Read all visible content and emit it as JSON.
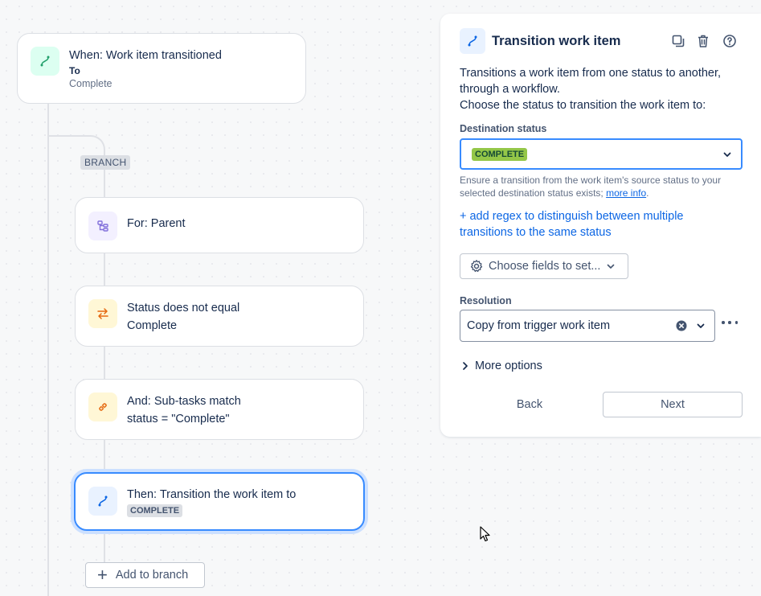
{
  "trigger": {
    "title": "When: Work item transitioned",
    "to_label": "To",
    "to_value": "Complete"
  },
  "branch": {
    "tag": "BRANCH"
  },
  "steps": [
    {
      "line1": "For: Parent",
      "line2": ""
    },
    {
      "line1": "Status does not equal",
      "line2": "Complete"
    },
    {
      "line1": "And: Sub-tasks match",
      "line2": "status = \"Complete\""
    },
    {
      "line1": "Then: Transition the work item to",
      "badge": "COMPLETE"
    }
  ],
  "add_branch": {
    "label": "Add to branch"
  },
  "panel": {
    "title": "Transition work item",
    "description_1": "Transitions a work item from one status to another,",
    "description_2": "through a workflow.",
    "description_3": "Choose the status to transition the work item to:",
    "destination_label": "Destination status",
    "destination_value": "COMPLETE",
    "helper_text": "Ensure a transition from the work item's source status to your selected destination status exists;",
    "helper_link": "more info",
    "helper_end": ".",
    "regex_link_1": "+ add regex to distinguish between multiple",
    "regex_link_2": "transitions to the same status",
    "choose_fields": "Choose fields to set...",
    "resolution_label": "Resolution",
    "resolution_value": "Copy from trigger work item",
    "more_options": "More options",
    "back": "Back",
    "next": "Next"
  },
  "colors": {
    "accent": "#0c66e4",
    "trigger_icon_bg": "#dcfff1",
    "branch_icon_bg": "#f3f0ff",
    "condition_icon_bg": "#fff7d6",
    "action_icon_bg": "#e9f2ff",
    "complete_green": "#94c748"
  }
}
